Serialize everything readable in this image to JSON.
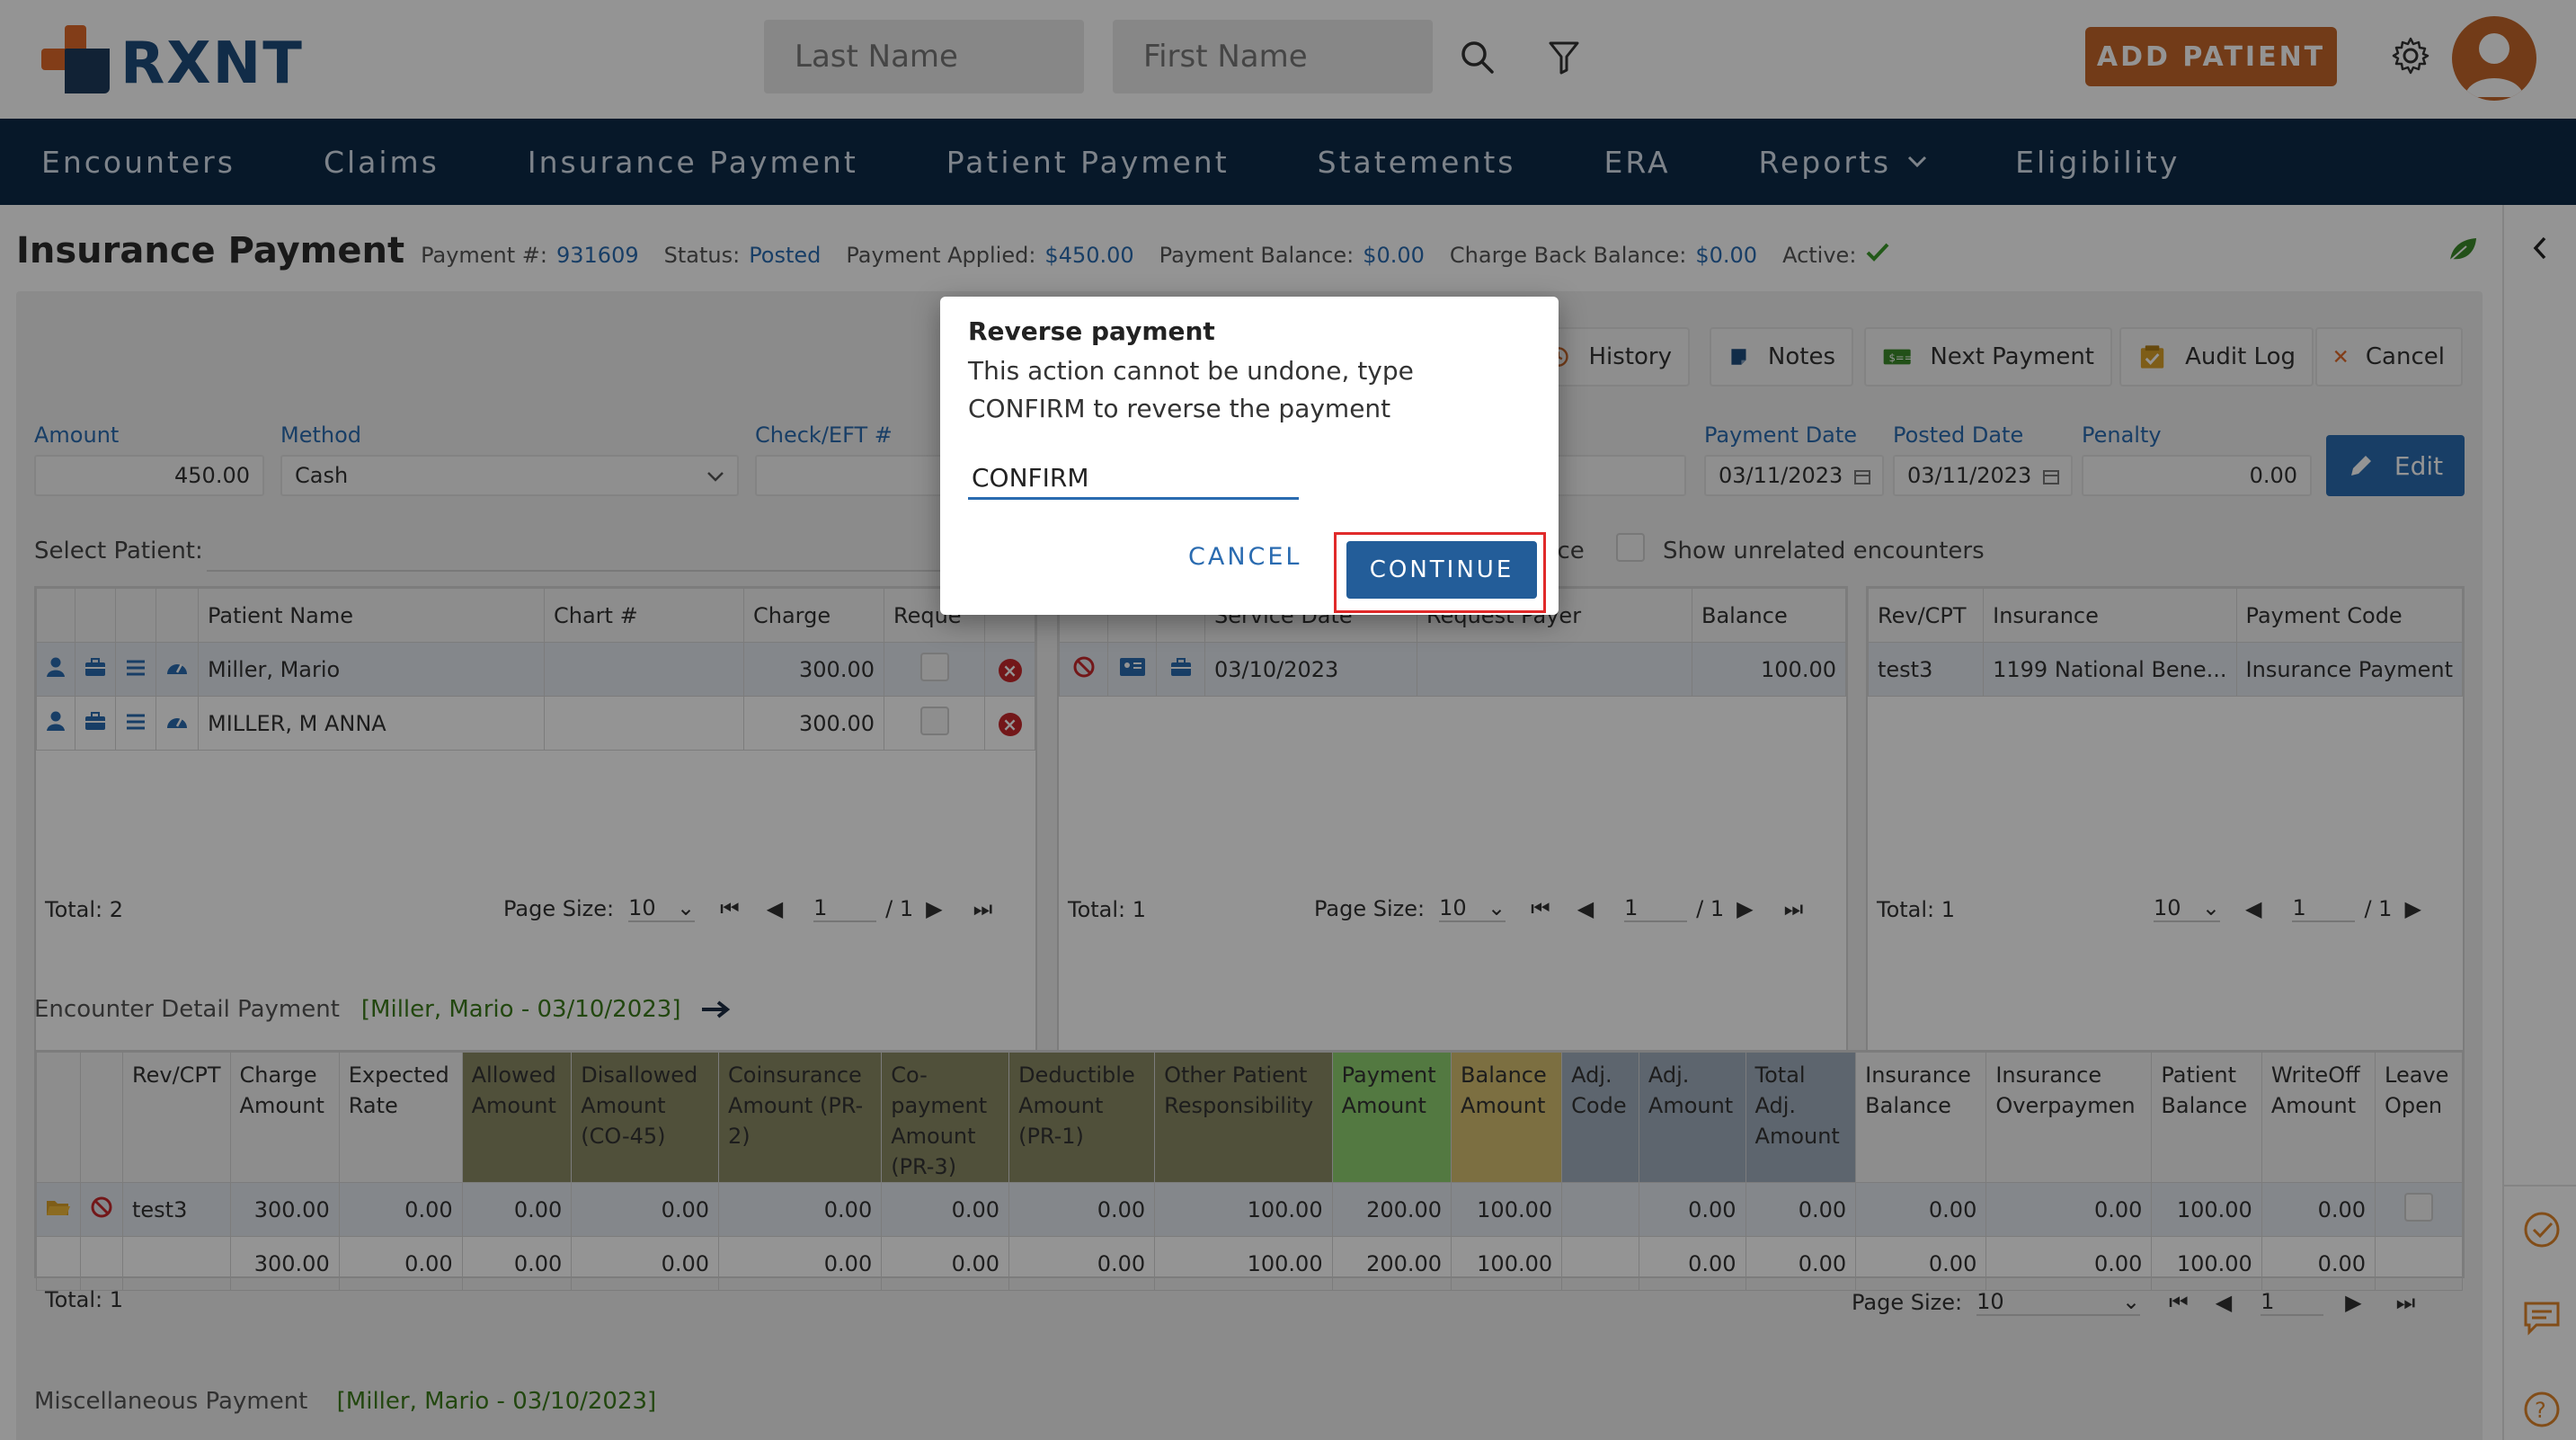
{
  "header": {
    "logo_text": "RXNT",
    "last_name_placeholder": "Last Name",
    "first_name_placeholder": "First Name",
    "add_patient_label": "ADD PATIENT",
    "colors": {
      "brand_orange": "#c5662a",
      "brand_navy": "#0d2a47",
      "link_blue": "#2a6bb0"
    }
  },
  "nav": {
    "items": [
      "Encounters",
      "Claims",
      "Insurance Payment",
      "Patient Payment",
      "Statements",
      "ERA",
      "Reports",
      "Eligibility"
    ]
  },
  "page": {
    "title": "Insurance Payment",
    "payment_no_label": "Payment #:",
    "payment_no": "931609",
    "status_label": "Status:",
    "status": "Posted",
    "applied_label": "Payment Applied:",
    "applied": "$450.00",
    "balance_label": "Payment Balance:",
    "balance": "$0.00",
    "chargeback_label": "Charge Back Balance:",
    "chargeback": "$0.00",
    "active_label": "Active:"
  },
  "toolbar": {
    "history": "History",
    "notes": "Notes",
    "next_payment": "Next Payment",
    "audit_log": "Audit Log",
    "cancel": "Cancel",
    "edit": "Edit"
  },
  "form": {
    "amount_label": "Amount",
    "amount": "450.00",
    "method_label": "Method",
    "method": "Cash",
    "check_label": "Check/EFT #",
    "payment_date_label": "Payment Date",
    "payment_date": "03/11/2023",
    "posted_date_label": "Posted Date",
    "posted_date": "03/11/2023",
    "penalty_label": "Penalty",
    "penalty": "0.00",
    "select_patient_label": "Select Patient:",
    "show_balance_partial": "nce",
    "show_unrelated": "Show unrelated encounters"
  },
  "patients": {
    "headers": [
      "Patient Name",
      "Chart #",
      "Charge",
      "Reque"
    ],
    "rows": [
      {
        "name": "Miller, Mario",
        "chart": "",
        "charge": "300.00"
      },
      {
        "name": "MILLER, M ANNA",
        "chart": "",
        "charge": "300.00"
      }
    ],
    "total": "Total: 2",
    "page_size_label": "Page Size:",
    "page_size": "10",
    "page": "1",
    "page_of": "/ 1"
  },
  "encounters": {
    "headers": [
      "Service Date",
      "Request Payer",
      "Balance"
    ],
    "rows": [
      {
        "date": "03/10/2023",
        "payer": "",
        "balance": "100.00"
      }
    ],
    "total": "Total: 1",
    "page_size_label": "Page Size:",
    "page_size": "10",
    "page": "1",
    "page_of": "/ 1"
  },
  "insurance": {
    "headers": [
      "Rev/CPT",
      "Insurance",
      "Payment Code"
    ],
    "rows": [
      {
        "cpt": "test3",
        "insurance": "1199 National Bene...",
        "code": "Insurance Payment"
      }
    ],
    "total": "Total: 1",
    "page_size": "10",
    "page": "1",
    "page_of": "/ 1"
  },
  "detail": {
    "label": "Encounter Detail Payment",
    "context": "[Miller, Mario - 03/10/2023]",
    "headers": [
      "Rev/CPT",
      "Charge Amount",
      "Expected Rate",
      "Allowed Amount",
      "Disallowed Amount (CO-45)",
      "Coinsurance Amount (PR-2)",
      "Co-payment Amount (PR-3)",
      "Deductible Amount (PR-1)",
      "Other Patient Responsibility",
      "Payment Amount",
      "Balance Amount",
      "Adj. Code",
      "Adj. Amount",
      "Total Adj. Amount",
      "Insurance Balance",
      "Insurance Overpaymen",
      "Patient Balance",
      "WriteOff Amount",
      "Leave Open"
    ],
    "row": [
      "test3",
      "300.00",
      "0.00",
      "0.00",
      "0.00",
      "0.00",
      "0.00",
      "0.00",
      "100.00",
      "200.00",
      "100.00",
      "",
      "0.00",
      "0.00",
      "0.00",
      "0.00",
      "100.00",
      "0.00"
    ],
    "totals": [
      "",
      "300.00",
      "0.00",
      "0.00",
      "0.00",
      "0.00",
      "0.00",
      "0.00",
      "100.00",
      "200.00",
      "100.00",
      "",
      "0.00",
      "0.00",
      "0.00",
      "0.00",
      "100.00",
      "0.00"
    ],
    "total": "Total: 1",
    "page_size_label": "Page Size:",
    "page_size": "10",
    "page": "1"
  },
  "misc": {
    "label": "Miscellaneous Payment",
    "context": "[Miller, Mario - 03/10/2023]"
  },
  "dialog": {
    "title": "Reverse payment",
    "message": "This action cannot be undone, type CONFIRM to reverse the payment",
    "input_value": "CONFIRM",
    "cancel_label": "CANCEL",
    "continue_label": "CONTINUE"
  }
}
